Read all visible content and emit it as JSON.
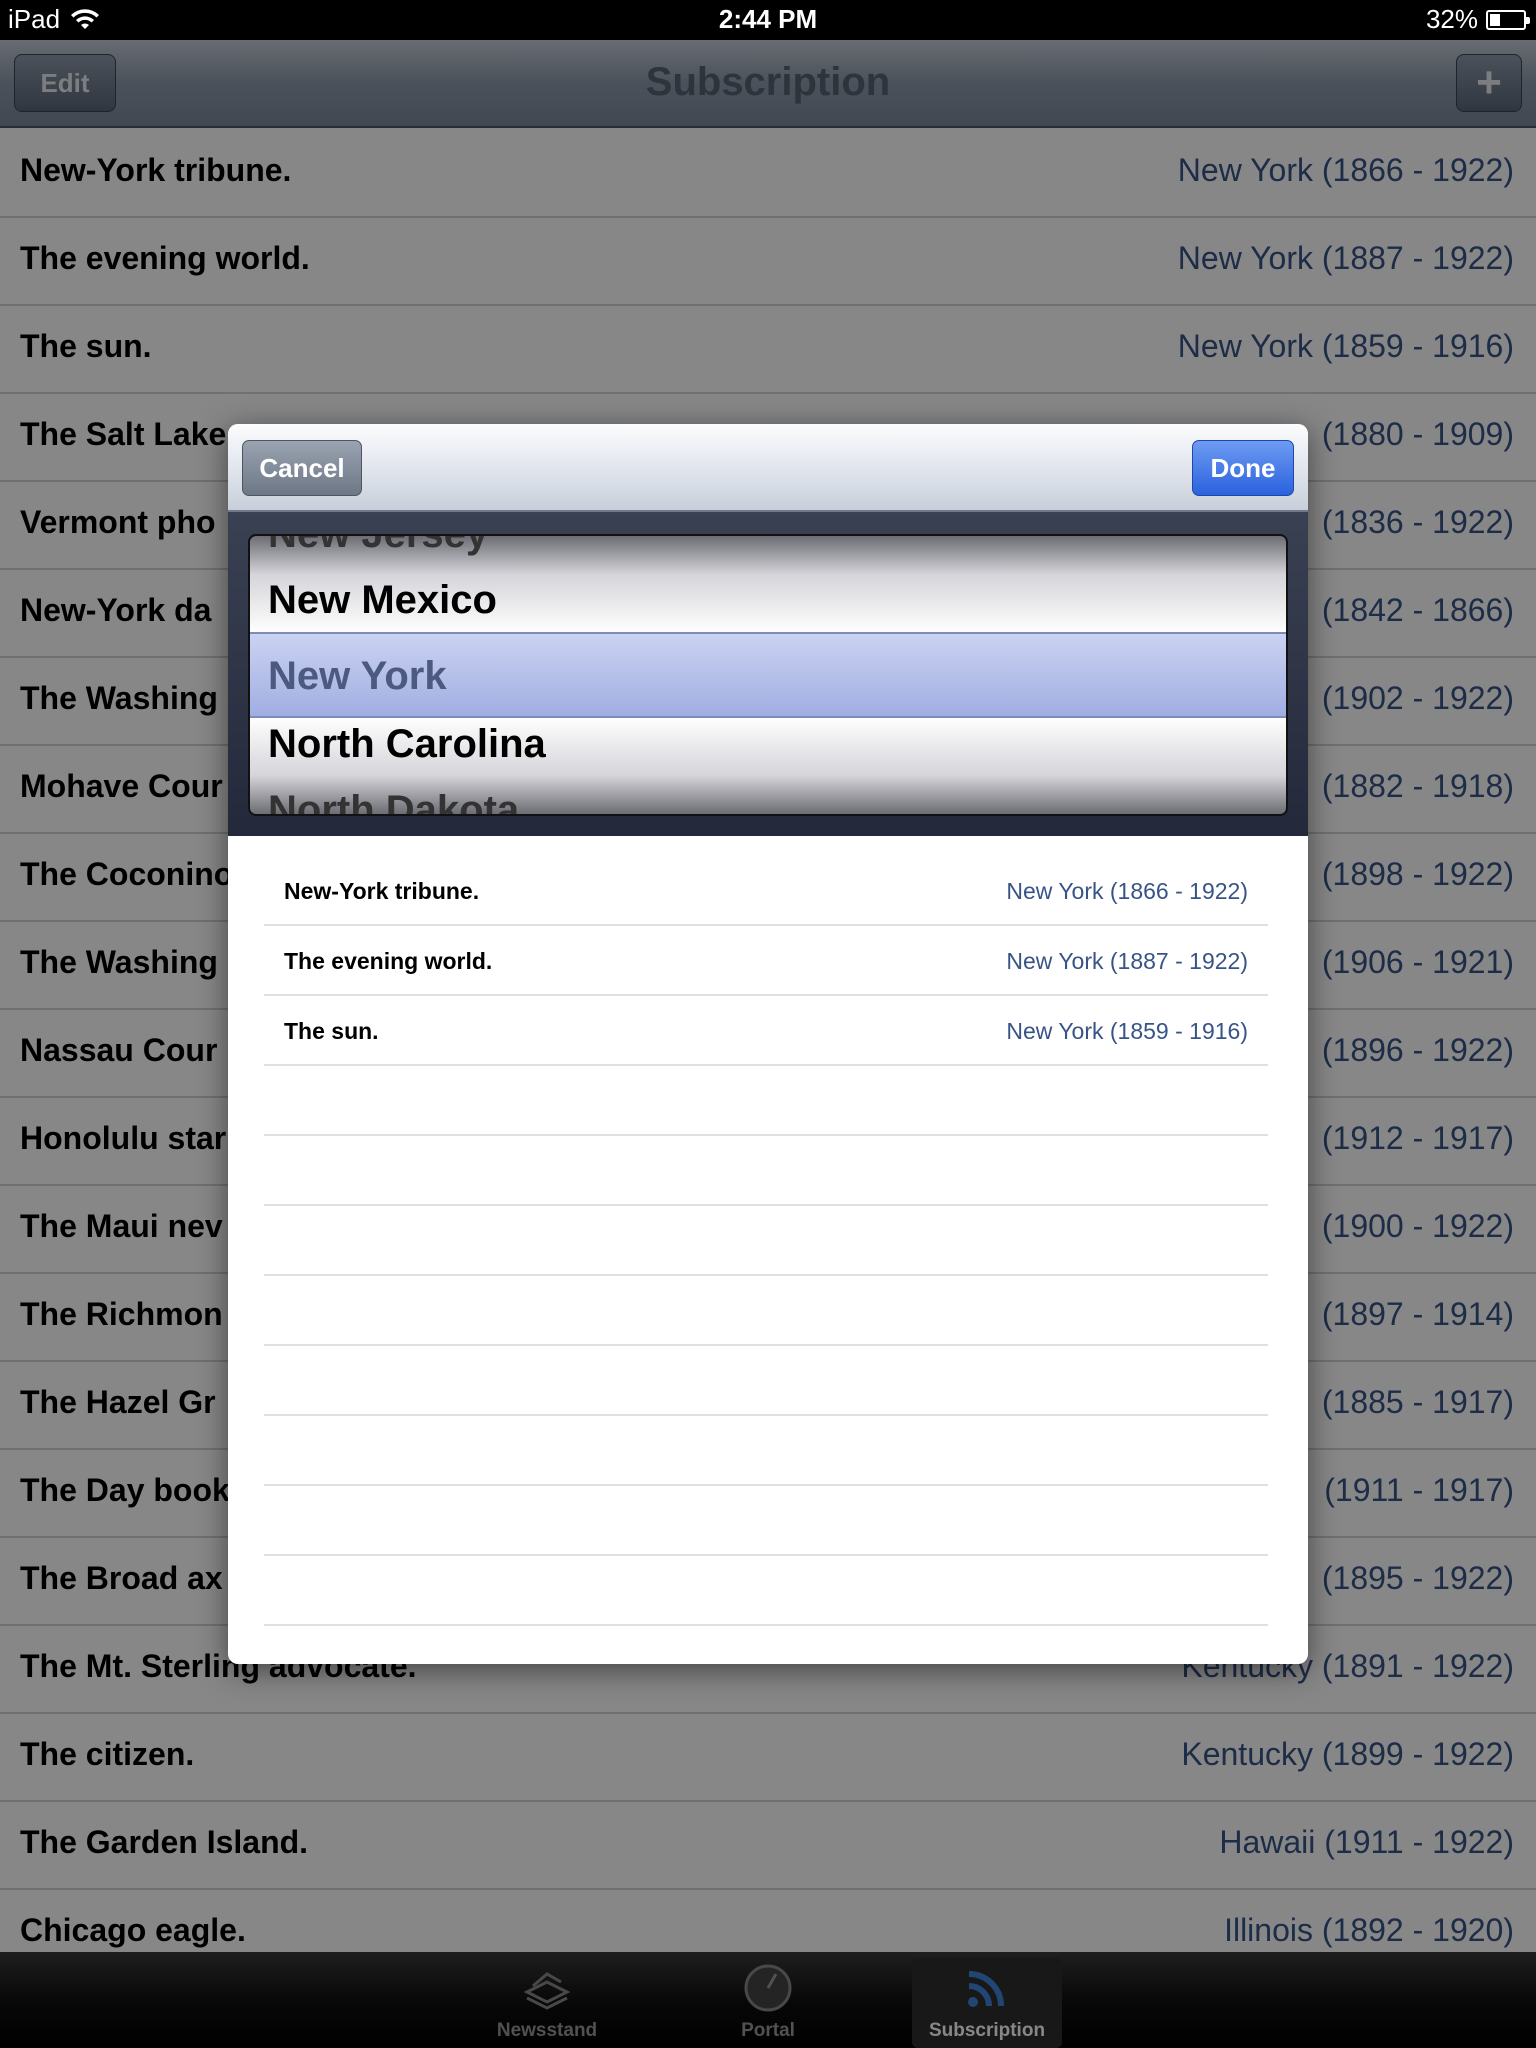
{
  "status_bar": {
    "device": "iPad",
    "time": "2:44 PM",
    "battery": "32%",
    "battery_level": 0.32
  },
  "nav": {
    "title": "Subscription",
    "edit_label": "Edit",
    "add_label": "+"
  },
  "list": [
    {
      "name": "New-York tribune.",
      "place": "New York (1866 - 1922)"
    },
    {
      "name": "The evening world.",
      "place": "New York (1887 - 1922)"
    },
    {
      "name": "The sun.",
      "place": "New York (1859 - 1916)"
    },
    {
      "name": "The Salt Lake",
      "place": "(1880 - 1909)"
    },
    {
      "name": "Vermont pho",
      "place": "(1836 - 1922)"
    },
    {
      "name": "New-York da",
      "place": "(1842 - 1866)"
    },
    {
      "name": "The Washing",
      "place": "(1902 - 1922)"
    },
    {
      "name": "Mohave Cour",
      "place": "(1882 - 1918)"
    },
    {
      "name": "The Coconino",
      "place": "(1898 - 1922)"
    },
    {
      "name": "The Washing",
      "place": "(1906 - 1921)"
    },
    {
      "name": "Nassau Cour",
      "place": "(1896 - 1922)"
    },
    {
      "name": "Honolulu star",
      "place": "(1912 - 1917)"
    },
    {
      "name": "The Maui nev",
      "place": "(1900 - 1922)"
    },
    {
      "name": "The Richmon",
      "place": "(1897 - 1914)"
    },
    {
      "name": "The Hazel Gr",
      "place": "(1885 - 1917)"
    },
    {
      "name": "The Day book",
      "place": "(1911 - 1917)"
    },
    {
      "name": "The Broad ax",
      "place": "(1895 - 1922)"
    },
    {
      "name": "The Mt. Sterling advocate.",
      "place": "Kentucky (1891 - 1922)"
    },
    {
      "name": "The citizen.",
      "place": "Kentucky (1899 - 1922)"
    },
    {
      "name": "The Garden Island.",
      "place": "Hawaii (1911 - 1922)"
    },
    {
      "name": "Chicago eagle.",
      "place": "Illinois (1892 - 1920)"
    }
  ],
  "modal": {
    "cancel_label": "Cancel",
    "done_label": "Done",
    "picker": {
      "options": [
        "New Jersey",
        "New Mexico",
        "New York",
        "North Carolina",
        "North Dakota"
      ],
      "selected": "New York"
    },
    "results": [
      {
        "name": "New-York tribune.",
        "place": "New York (1866 - 1922)"
      },
      {
        "name": "The evening world.",
        "place": "New York (1887 - 1922)"
      },
      {
        "name": "The sun.",
        "place": "New York (1859 - 1916)"
      }
    ],
    "empty_rows": 8
  },
  "tabs": [
    {
      "label": "Newsstand",
      "icon": "newsstand-icon",
      "active": false
    },
    {
      "label": "Portal",
      "icon": "clock-icon",
      "active": false
    },
    {
      "label": "Subscription",
      "icon": "rss-icon",
      "active": true
    }
  ]
}
